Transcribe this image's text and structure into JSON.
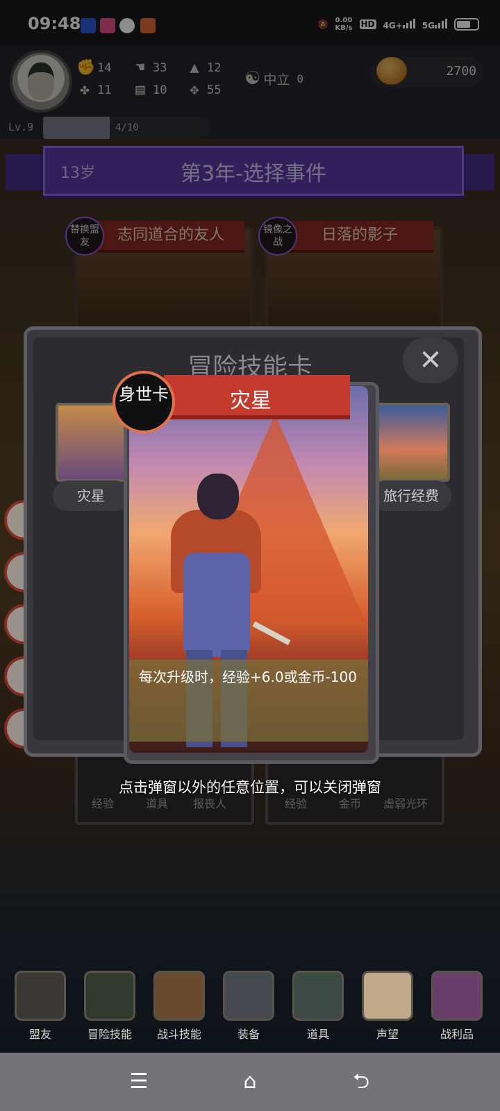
{
  "status_bar": {
    "time": "09:48",
    "net_speed_value": "0.00",
    "net_speed_unit": "KB/s",
    "hd": "HD",
    "sim1": "4G+",
    "sim2": "5G"
  },
  "player": {
    "stats": [
      {
        "icon": "fist-icon",
        "value": "14"
      },
      {
        "icon": "clover-icon",
        "value": "11"
      },
      {
        "icon": "hand-icon",
        "value": "33"
      },
      {
        "icon": "book-icon",
        "value": "10"
      },
      {
        "icon": "wizard-hat-icon",
        "value": "12"
      },
      {
        "icon": "wings-icon",
        "value": "55"
      }
    ],
    "alignment_label": "中立",
    "alignment_value": "0",
    "gold": "2700",
    "level": "Lv.9",
    "exp_text": "4/10",
    "exp_fraction": 0.4
  },
  "ribbon": {
    "age": "13岁",
    "title": "第3年-选择事件"
  },
  "events": [
    {
      "badge": "替换盟友",
      "title": "志同道合的友人"
    },
    {
      "badge": "镜像之战",
      "title": "日落的影子"
    }
  ],
  "modal": {
    "title": "冒险技能卡",
    "close_symbol": "✕",
    "left_card_label": "灾星",
    "right_card_label": "旅行经费",
    "card": {
      "badge": "身世卡",
      "name": "灾星",
      "description": "每次升级时，经验+6.0或金币-100"
    },
    "hint": "点击弹窗以外的任意位置，可以关闭弹窗"
  },
  "background_cards": {
    "left_labels": [
      "经验",
      "道具",
      "报丧人"
    ],
    "right_labels": [
      "经验",
      "金币",
      "虚弱光环"
    ]
  },
  "nav": [
    {
      "label": "盟友",
      "icon": "gloves-icon"
    },
    {
      "label": "冒险技能",
      "icon": "spellbook-icon"
    },
    {
      "label": "战斗技能",
      "icon": "backpack-icon"
    },
    {
      "label": "装备",
      "icon": "crossed-swords-icon"
    },
    {
      "label": "道具",
      "icon": "satchel-icon"
    },
    {
      "label": "声望",
      "icon": "scroll-icon"
    },
    {
      "label": "战利品",
      "icon": "treasure-chest-icon"
    }
  ],
  "system_nav": {
    "menu": "☰",
    "home": "⌂",
    "back": "⮌"
  }
}
